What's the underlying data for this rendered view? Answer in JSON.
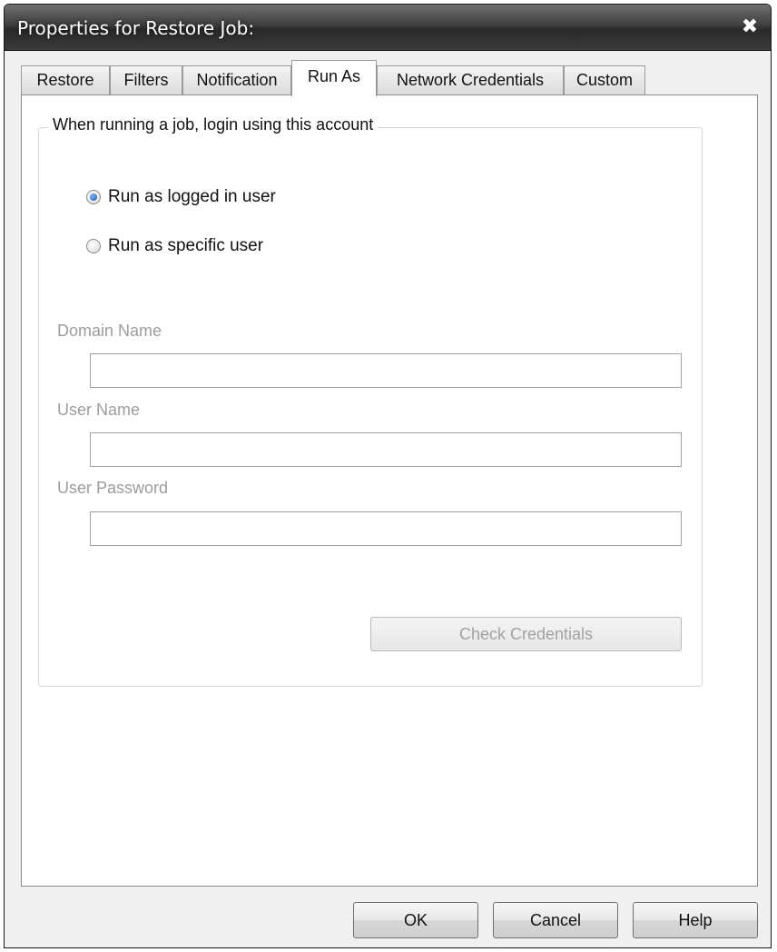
{
  "window": {
    "title": "Properties for Restore Job:",
    "close_glyph": "✖"
  },
  "tabs": [
    {
      "label": "Restore",
      "active": false
    },
    {
      "label": "Filters",
      "active": false
    },
    {
      "label": "Notification",
      "active": false
    },
    {
      "label": "Run As",
      "active": true
    },
    {
      "label": "Network Credentials",
      "active": false
    },
    {
      "label": "Custom",
      "active": false
    }
  ],
  "run_as": {
    "group_title": "When running a job, login using this account",
    "options": [
      {
        "label": "Run as logged in user",
        "checked": true
      },
      {
        "label": "Run as specific user",
        "checked": false
      }
    ],
    "domain_name_label": "Domain Name",
    "domain_name_value": "",
    "user_name_label": "User Name",
    "user_name_value": "",
    "user_password_label": "User Password",
    "user_password_value": "",
    "check_credentials_label": "Check Credentials"
  },
  "buttons": {
    "ok": "OK",
    "cancel": "Cancel",
    "help": "Help"
  },
  "colors": {
    "radio_selected": "#1c58ad",
    "disabled_text": "#9c9c9c"
  }
}
